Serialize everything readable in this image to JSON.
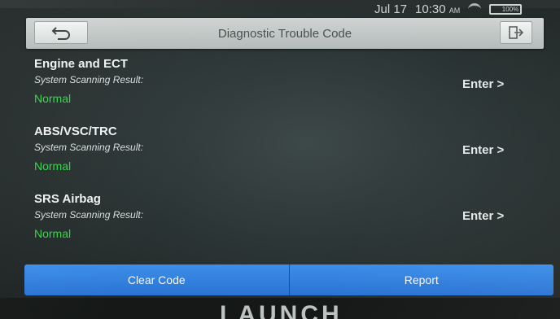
{
  "status_bar": {
    "date": "Jul 17",
    "time": "10:30",
    "ampm": "AM",
    "battery": "100%"
  },
  "header": {
    "title": "Diagnostic Trouble Code",
    "back_icon": "back-arrow-icon",
    "exit_icon": "exit-icon"
  },
  "systems": [
    {
      "name": "Engine and ECT",
      "result_label": "System Scanning Result:",
      "status": "Normal",
      "enter_label": "Enter >"
    },
    {
      "name": "ABS/VSC/TRC",
      "result_label": "System Scanning Result:",
      "status": "Normal",
      "enter_label": "Enter >"
    },
    {
      "name": "SRS Airbag",
      "result_label": "System Scanning Result:",
      "status": "Normal",
      "enter_label": "Enter >"
    }
  ],
  "actions": {
    "clear_code": "Clear Code",
    "report": "Report"
  },
  "device": {
    "brand": "LAUNCH"
  },
  "colors": {
    "status_ok": "#35d44a",
    "button_blue": "#2f80e0",
    "title_bar": "#c4c9c8"
  }
}
